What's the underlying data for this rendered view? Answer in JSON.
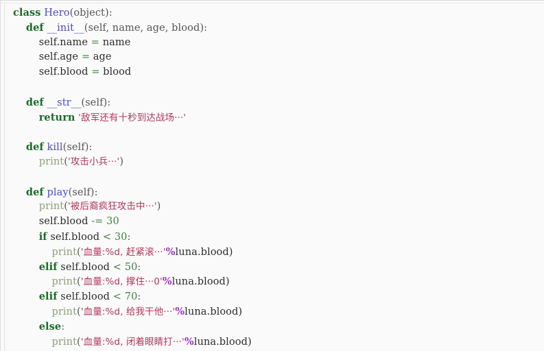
{
  "viewer": {
    "title": "Python Code Snippet",
    "language": "python",
    "background_color": "#fafafa",
    "border_color": "#dcdcdc",
    "font_size_px": 14.5,
    "line_height_px": 21.8
  },
  "theme": {
    "keyword_color": "#1a6b28",
    "name_color": "#4a4ad0",
    "builtin_color": "#8f9e7a",
    "string_color": "#b3365a",
    "number_color": "#3f7f3f",
    "operator_color": "#3f7f3f",
    "percent_color": "#9b30c8",
    "plain_color": "#2b2b2b"
  },
  "code": {
    "line_01": {
      "kw": "class",
      "sp1": " ",
      "name": "Hero",
      "rest": "(object):"
    },
    "line_02": {
      "indent": "    ",
      "kw": "def",
      "sp1": " ",
      "name": "__init__",
      "rest": "(self, name, age, blood):"
    },
    "line_03": {
      "indent": "        ",
      "lhs": "self.name ",
      "op": "=",
      "rhs": " name"
    },
    "line_04": {
      "indent": "        ",
      "lhs": "self.age ",
      "op": "=",
      "rhs": " age"
    },
    "line_05": {
      "indent": "        ",
      "lhs": "self.blood ",
      "op": "=",
      "rhs": " blood"
    },
    "line_06": {
      "blank": ""
    },
    "line_07": {
      "indent": "    ",
      "kw": "def",
      "sp1": " ",
      "name": "__str__",
      "rest": "(self):"
    },
    "line_08": {
      "indent": "        ",
      "kw": "return",
      "sp1": " ",
      "str": "'敌军还有十秒到达战场···'"
    },
    "line_09": {
      "blank": ""
    },
    "line_10": {
      "indent": "    ",
      "kw": "def",
      "sp1": " ",
      "name": "kill",
      "rest": "(self):"
    },
    "line_11": {
      "indent": "        ",
      "builtin": "print",
      "open": "(",
      "str": "'攻击小兵···'",
      "close": ")"
    },
    "line_12": {
      "blank": ""
    },
    "line_13": {
      "indent": "    ",
      "kw": "def",
      "sp1": " ",
      "name": "play",
      "rest": "(self):"
    },
    "line_14": {
      "indent": "        ",
      "builtin": "print",
      "open": "(",
      "str": "'被后裔疯狂攻击中···'",
      "close": ")"
    },
    "line_15": {
      "indent": "        ",
      "lhs": "self.blood ",
      "op": "-=",
      "sp": " ",
      "num": "30"
    },
    "line_16": {
      "indent": "        ",
      "kw": "if",
      "expr": " self.blood ",
      "op": "<",
      "sp": " ",
      "num": "30",
      "colon": ":"
    },
    "line_17": {
      "indent": "            ",
      "builtin": "print",
      "open": "(",
      "str": "'血量:%d, 赶紧滚···'",
      "pct": "%",
      "tail": "luna.blood)"
    },
    "line_18": {
      "indent": "        ",
      "kw": "elif",
      "expr": " self.blood ",
      "op": "<",
      "sp": " ",
      "num": "50",
      "colon": ":"
    },
    "line_19": {
      "indent": "            ",
      "builtin": "print",
      "open": "(",
      "str": "'血量:%d, 撑住···0'",
      "pct": "%",
      "tail": "luna.blood)"
    },
    "line_20": {
      "indent": "        ",
      "kw": "elif",
      "expr": " self.blood ",
      "op": "<",
      "sp": " ",
      "num": "70",
      "colon": ":"
    },
    "line_21": {
      "indent": "            ",
      "builtin": "print",
      "open": "(",
      "str": "'血量:%d, 给我干他···'",
      "pct": "%",
      "tail": "luna.blood)"
    },
    "line_22": {
      "indent": "        ",
      "kw": "else",
      "colon": ":"
    },
    "line_23": {
      "indent": "            ",
      "builtin": "print",
      "open": "(",
      "str": "'血量:%d, 闭着眼睛打···'",
      "pct": "%",
      "tail": "luna.blood)"
    }
  }
}
